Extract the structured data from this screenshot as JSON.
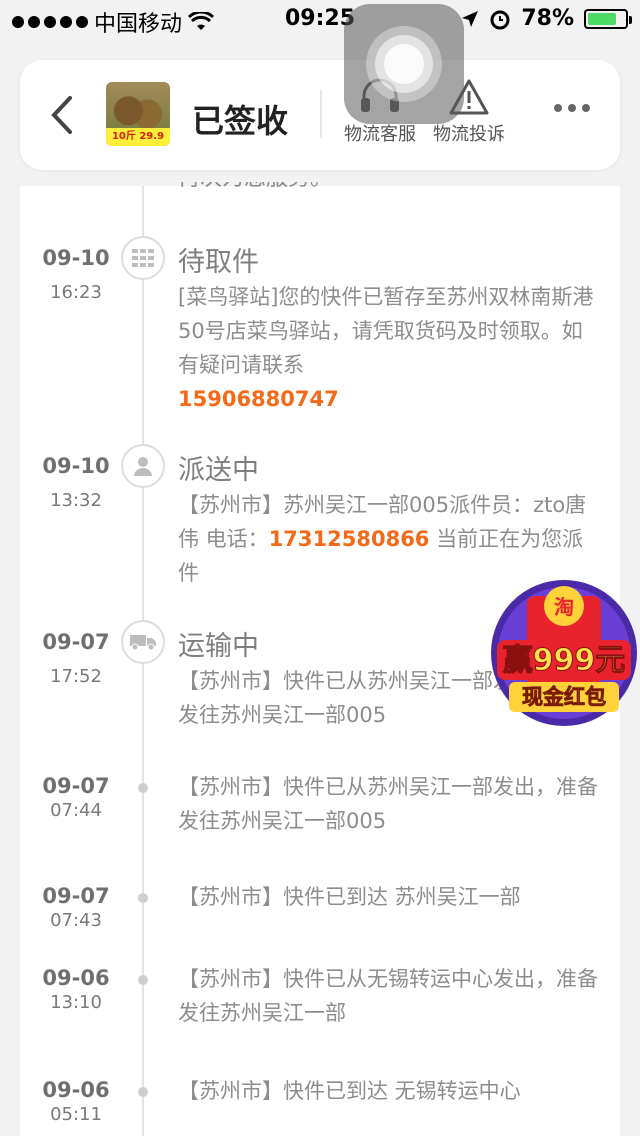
{
  "status_bar": {
    "carrier": "中国移动",
    "time": "09:25",
    "battery": "78%",
    "battery_level": 0.78
  },
  "header": {
    "title": "已签收",
    "thumb_tag": "10斤 29.9",
    "actions": [
      {
        "label": "物流客服",
        "icon": "headset-icon"
      },
      {
        "label": "物流投诉",
        "icon": "warning-icon"
      }
    ]
  },
  "cutoff_text": "再次为您服务。",
  "timeline": [
    {
      "date": "09-10",
      "time": "16:23",
      "title": "待取件",
      "icon": "locker-icon",
      "desc": "[菜鸟驿站]您的快件已暂存至苏州双林南斯港50号店菜鸟驿站，请凭取货码及时领取。如有疑问请联系",
      "phone": "15906880747",
      "desc_after": ""
    },
    {
      "date": "09-10",
      "time": "13:32",
      "title": "派送中",
      "icon": "courier-icon",
      "desc": "【苏州市】苏州吴江一部005派件员：zto唐伟 电话：",
      "phone": "17312580866",
      "desc_after": " 当前正在为您派件"
    },
    {
      "date": "09-07",
      "time": "17:52",
      "title": "运输中",
      "icon": "truck-icon",
      "desc": "【苏州市】快件已从苏州吴江一部发出，准备发往苏州吴江一部005",
      "phone": "",
      "desc_after": ""
    },
    {
      "date": "09-07",
      "time": "07:44",
      "title": "",
      "icon": "",
      "desc": "【苏州市】快件已从苏州吴江一部发出，准备发往苏州吴江一部005",
      "phone": "",
      "desc_after": ""
    },
    {
      "date": "09-07",
      "time": "07:43",
      "title": "",
      "icon": "",
      "desc": "【苏州市】快件已到达 苏州吴江一部",
      "phone": "",
      "desc_after": ""
    },
    {
      "date": "09-06",
      "time": "13:10",
      "title": "",
      "icon": "",
      "desc": "【苏州市】快件已从无锡转运中心发出，准备发往苏州吴江一部",
      "phone": "",
      "desc_after": ""
    },
    {
      "date": "09-06",
      "time": "05:11",
      "title": "",
      "icon": "",
      "desc": "【苏州市】快件已到达 无锡转运中心",
      "phone": "",
      "desc_after": ""
    }
  ],
  "promo": {
    "line1": "赢999元",
    "line2": "现金红包",
    "coin": "淘"
  },
  "colors": {
    "accent": "#f36b1a",
    "promo_red": "#e8232d",
    "promo_gold": "#ffd23a"
  }
}
